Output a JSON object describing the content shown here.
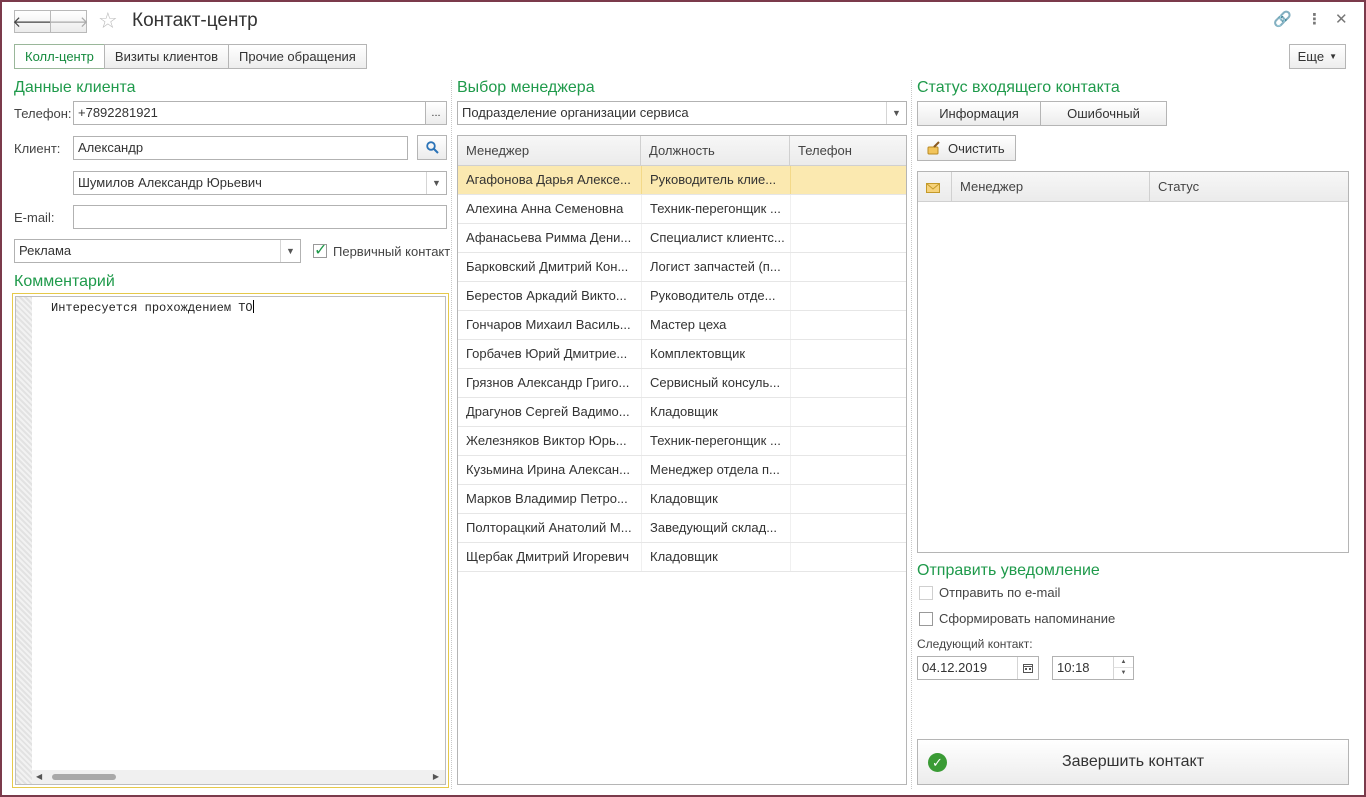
{
  "window": {
    "title": "Контакт-центр",
    "nav": {
      "back": "🡐",
      "forward": "🡒"
    },
    "icons": {
      "favorite": "☆",
      "link": "🔗",
      "menu": "⋮",
      "close": "✕"
    }
  },
  "tabs": [
    {
      "label": "Колл-центр",
      "active": true
    },
    {
      "label": "Визиты клиентов",
      "active": false
    },
    {
      "label": "Прочие обращения",
      "active": false
    }
  ],
  "more_label": "Еще",
  "client": {
    "section_title": "Данные клиента",
    "phone_label": "Телефон:",
    "phone_value": "+7892281921",
    "phone_button": "...",
    "client_label": "Клиент:",
    "client_value": "Александр",
    "client_full": "Шумилов Александр Юрьевич",
    "email_label": "E-mail:",
    "email_value": "",
    "source_value": "Реклама",
    "primary_label": "Первичный контакт",
    "primary_checked": true
  },
  "comment": {
    "section_title": "Комментарий",
    "text": "Интересуется прохождением ТО"
  },
  "manager_select": {
    "section_title": "Выбор менеджера",
    "department_value": "Подразделение организации сервиса",
    "columns": [
      "Менеджер",
      "Должность",
      "Телефон"
    ],
    "rows": [
      {
        "name": "Агафонова Дарья Алексе...",
        "position": "Руководитель клие...",
        "phone": "",
        "selected": true
      },
      {
        "name": "Алехина Анна Семеновна",
        "position": "Техник-перегонщик ...",
        "phone": ""
      },
      {
        "name": "Афанасьева Римма Дени...",
        "position": "Специалист клиентс...",
        "phone": ""
      },
      {
        "name": "Барковский Дмитрий Кон...",
        "position": "Логист запчастей (п...",
        "phone": ""
      },
      {
        "name": "Берестов Аркадий Викто...",
        "position": "Руководитель отде...",
        "phone": ""
      },
      {
        "name": "Гончаров Михаил Василь...",
        "position": "Мастер цеха",
        "phone": ""
      },
      {
        "name": "Горбачев Юрий Дмитрие...",
        "position": "Комплектовщик",
        "phone": ""
      },
      {
        "name": "Грязнов Александр Григо...",
        "position": "Сервисный консуль...",
        "phone": ""
      },
      {
        "name": "Драгунов Сергей Вадимо...",
        "position": "Кладовщик",
        "phone": ""
      },
      {
        "name": "Железняков Виктор Юрь...",
        "position": "Техник-перегонщик ...",
        "phone": ""
      },
      {
        "name": "Кузьмина Ирина Алексан...",
        "position": "Менеджер отдела п...",
        "phone": ""
      },
      {
        "name": "Марков Владимир Петро...",
        "position": "Кладовщик",
        "phone": ""
      },
      {
        "name": "Полторацкий Анатолий М...",
        "position": "Заведующий склад...",
        "phone": ""
      },
      {
        "name": "Щербак Дмитрий Игоревич",
        "position": "Кладовщик",
        "phone": ""
      }
    ]
  },
  "status": {
    "section_title": "Статус входящего контакта",
    "info_button": "Информация",
    "error_button": "Ошибочный",
    "clear_button": "Очистить",
    "columns": [
      "Менеджер",
      "Статус"
    ]
  },
  "notify": {
    "section_title": "Отправить уведомление",
    "email_label": "Отправить по e-mail",
    "email_checked": false,
    "email_disabled": true,
    "reminder_label": "Сформировать напоминание",
    "reminder_checked": false,
    "next_label": "Следующий контакт:",
    "date_value": "04.12.2019",
    "time_value": "10:18"
  },
  "finish_label": "Завершить контакт",
  "colors": {
    "accent": "#1f9a4b",
    "selection": "#fbe9b0",
    "border": "#7b3a4b"
  }
}
